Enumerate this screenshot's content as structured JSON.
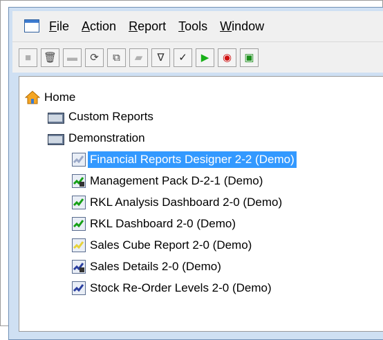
{
  "menubar": {
    "items": [
      {
        "label": "File",
        "accel": "F",
        "rest": "ile"
      },
      {
        "label": "Action",
        "accel": "A",
        "rest": "ction"
      },
      {
        "label": "Report",
        "accel": "R",
        "rest": "eport"
      },
      {
        "label": "Tools",
        "accel": "T",
        "rest": "ools"
      },
      {
        "label": "Window",
        "accel": "W",
        "rest": "indow"
      }
    ]
  },
  "toolbar": {
    "buttons": [
      {
        "icon": "stop-square-icon",
        "glyph": "■",
        "color": "#b0b0b0"
      },
      {
        "icon": "delete-icon",
        "glyph": "🗑",
        "color": "#444444"
      },
      {
        "icon": "window-icon",
        "glyph": "▬",
        "color": "#b0b0b0"
      },
      {
        "icon": "refresh-icon",
        "glyph": "⟳",
        "color": "#444444"
      },
      {
        "icon": "copy-icon",
        "glyph": "⧉",
        "color": "#444444"
      },
      {
        "icon": "folder-icon",
        "glyph": "▰",
        "color": "#b0b0b0"
      },
      {
        "icon": "filter-icon",
        "glyph": "∇",
        "color": "#333333"
      },
      {
        "icon": "check-icon",
        "glyph": "✓",
        "color": "#222222"
      },
      {
        "icon": "run-icon",
        "glyph": "▶",
        "color": "#18b018"
      },
      {
        "icon": "schedule-icon",
        "glyph": "◉",
        "color": "#d01010"
      },
      {
        "icon": "windows-icon",
        "glyph": "▣",
        "color": "#1a8f1a"
      }
    ]
  },
  "tree": {
    "home": "Home",
    "folders": [
      "Custom Reports",
      "Demonstration"
    ],
    "reports": [
      {
        "label": "Financial Reports Designer 2-2 (Demo)",
        "selected": true,
        "icon": "report-chart-icon",
        "color": "#9aa8c8",
        "lock": false
      },
      {
        "label": "Management Pack D-2-1 (Demo)",
        "selected": false,
        "icon": "report-chart-locked-icon",
        "color": "#16a016",
        "lock": true
      },
      {
        "label": "RKL Analysis Dashboard 2-0 (Demo)",
        "selected": false,
        "icon": "report-chart-icon",
        "color": "#16a016",
        "lock": false
      },
      {
        "label": "RKL Dashboard 2-0 (Demo)",
        "selected": false,
        "icon": "report-chart-icon",
        "color": "#16a016",
        "lock": false
      },
      {
        "label": "Sales Cube Report 2-0 (Demo)",
        "selected": false,
        "icon": "report-chart-icon",
        "color": "#e6d23a",
        "lock": false
      },
      {
        "label": "Sales Details 2-0 (Demo)",
        "selected": false,
        "icon": "report-chart-locked-icon",
        "color": "#2a3fa0",
        "lock": true
      },
      {
        "label": "Stock Re-Order Levels 2-0 (Demo)",
        "selected": false,
        "icon": "report-chart-icon",
        "color": "#2a3fa0",
        "lock": false
      }
    ]
  }
}
